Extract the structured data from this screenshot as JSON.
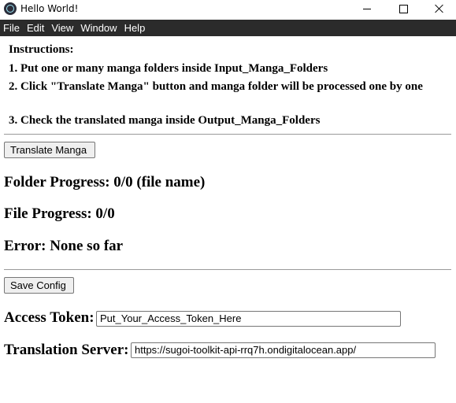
{
  "window": {
    "title": "Hello World!"
  },
  "menu": [
    "File",
    "Edit",
    "View",
    "Window",
    "Help"
  ],
  "instructions": {
    "heading": "Instructions:",
    "step1": "1. Put one or many manga folders inside Input_Manga_Folders",
    "step2": "2. Click \"Translate Manga\" button and manga folder will be processed one by one",
    "step3": "3. Check the translated manga inside Output_Manga_Folders"
  },
  "buttons": {
    "translate": "Translate Manga",
    "save_config": "Save Config"
  },
  "status": {
    "folder_progress": "Folder Progress: 0/0 (file name)",
    "file_progress": "File Progress: 0/0",
    "error": "Error: None so far"
  },
  "config": {
    "access_token_label": "Access Token:",
    "access_token_value": "Put_Your_Access_Token_Here",
    "server_label": "Translation Server:",
    "server_value": "https://sugoi-toolkit-api-rrq7h.ondigitalocean.app/"
  }
}
